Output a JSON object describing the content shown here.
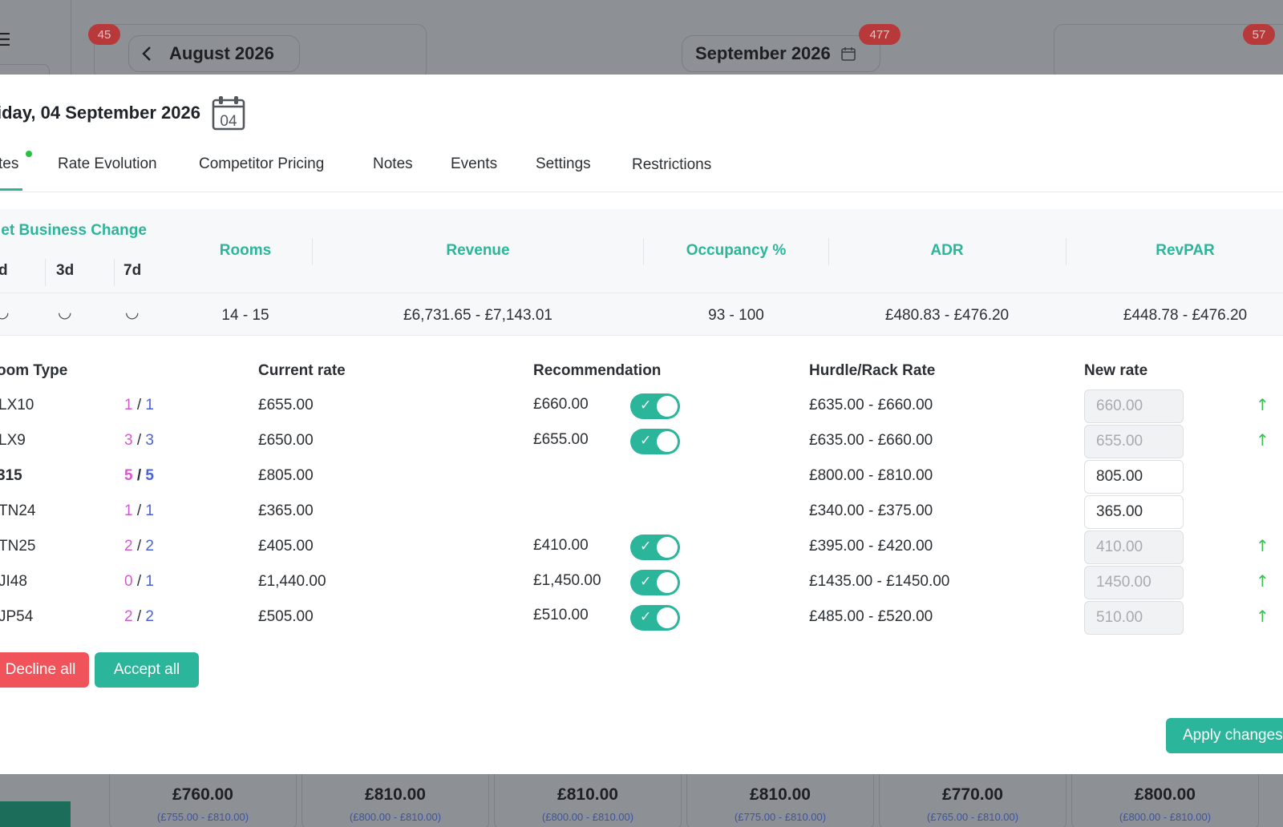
{
  "background": {
    "badges": [
      "45",
      "477",
      "57"
    ],
    "prev_month": "August 2026",
    "current_month": "September 2026",
    "bottom_prices": [
      {
        "price": "£760.00",
        "range": "(£755.00 - £810.00)"
      },
      {
        "price": "£810.00",
        "range": "(£800.00 - £810.00)"
      },
      {
        "price": "£810.00",
        "range": "(£800.00 - £810.00)"
      },
      {
        "price": "£810.00",
        "range": "(£775.00 - £810.00)"
      },
      {
        "price": "£770.00",
        "range": "(£765.00 - £810.00)"
      },
      {
        "price": "£800.00",
        "range": "(£800.00 - £810.00)"
      }
    ]
  },
  "modal": {
    "title": "iday, 04 September 2026",
    "calendar_day": "04",
    "tabs": [
      "tes",
      "Rate Evolution",
      "Competitor Pricing",
      "Notes",
      "Events",
      "Settings",
      "Restrictions"
    ],
    "summary": {
      "title": "let Business Change",
      "periods": [
        "d",
        "3d",
        "7d"
      ],
      "period_values": [
        "◡",
        "◡",
        "◡"
      ],
      "metrics": [
        {
          "label": "Rooms",
          "value": "14 - 15"
        },
        {
          "label": "Revenue",
          "value": "£6,731.65 - £7,143.01"
        },
        {
          "label": "Occupancy %",
          "value": "93 - 100"
        },
        {
          "label": "ADR",
          "value": "£480.83 - £476.20"
        },
        {
          "label": "RevPAR",
          "value": "£448.78 - £476.20"
        }
      ]
    },
    "rates_table": {
      "headers": {
        "room_type": "oom Type",
        "current_rate": "Current rate",
        "recommendation": "Recommendation",
        "hurdle": "Hurdle/Rack Rate",
        "new_rate": "New rate"
      },
      "rows": [
        {
          "name": "LX10",
          "avail_a": "1",
          "avail_b": "1",
          "current": "£655.00",
          "recommendation": "£660.00",
          "toggle": true,
          "hurdle": "£635.00 - £660.00",
          "new_rate": "660.00",
          "disabled": true,
          "up": true,
          "bold": false
        },
        {
          "name": "LX9",
          "avail_a": "3",
          "avail_b": "3",
          "current": "£650.00",
          "recommendation": "£655.00",
          "toggle": true,
          "hurdle": "£635.00 - £660.00",
          "new_rate": "655.00",
          "disabled": true,
          "up": true,
          "bold": false
        },
        {
          "name": "315",
          "avail_a": "5",
          "avail_b": "5",
          "current": "£805.00",
          "recommendation": "",
          "toggle": false,
          "hurdle": "£800.00 - £810.00",
          "new_rate": "805.00",
          "disabled": false,
          "up": false,
          "bold": true
        },
        {
          "name": "TN24",
          "avail_a": "1",
          "avail_b": "1",
          "current": "£365.00",
          "recommendation": "",
          "toggle": false,
          "hurdle": "£340.00 - £375.00",
          "new_rate": "365.00",
          "disabled": false,
          "up": false,
          "bold": false
        },
        {
          "name": "TN25",
          "avail_a": "2",
          "avail_b": "2",
          "current": "£405.00",
          "recommendation": "£410.00",
          "toggle": true,
          "hurdle": "£395.00 - £420.00",
          "new_rate": "410.00",
          "disabled": true,
          "up": true,
          "bold": false
        },
        {
          "name": "JI48",
          "avail_a": "0",
          "avail_b": "1",
          "current": "£1,440.00",
          "recommendation": "£1,450.00",
          "toggle": true,
          "hurdle": "£1435.00 - £1450.00",
          "new_rate": "1450.00",
          "disabled": true,
          "up": true,
          "bold": false
        },
        {
          "name": "JP54",
          "avail_a": "2",
          "avail_b": "2",
          "current": "£505.00",
          "recommendation": "£510.00",
          "toggle": true,
          "hurdle": "£485.00 - £520.00",
          "new_rate": "510.00",
          "disabled": true,
          "up": true,
          "bold": false
        }
      ]
    },
    "buttons": {
      "decline_all": "Decline all",
      "accept_all": "Accept all",
      "apply_changes": "Apply changes"
    }
  },
  "colors": {
    "accent": "#2bb59a",
    "decline": "#f0545a",
    "badge": "#b8393a",
    "avail_pink": "#d35ad0",
    "avail_blue": "#4b62d6",
    "up_arrow": "#32c24a"
  }
}
